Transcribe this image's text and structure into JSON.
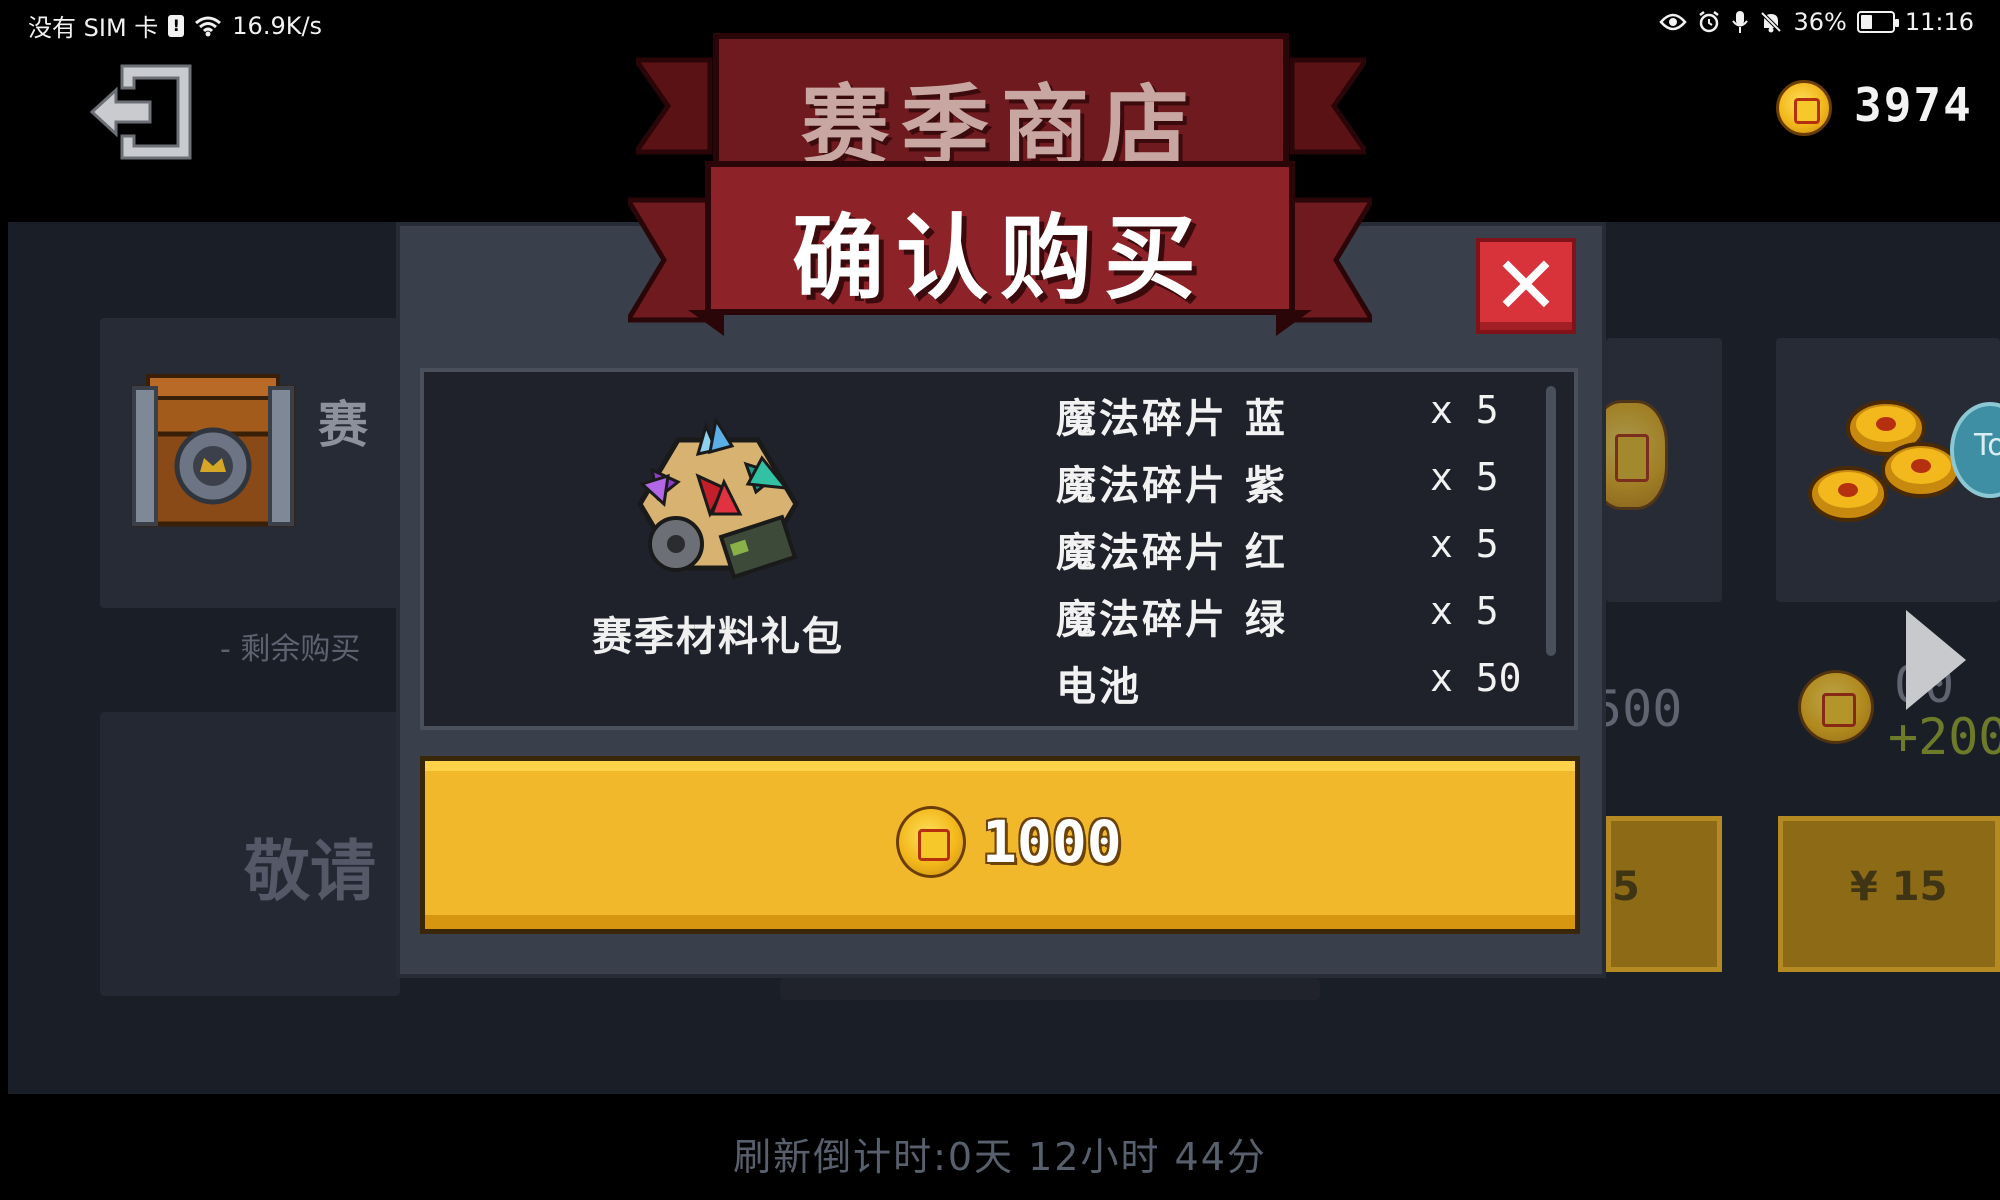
{
  "status_bar": {
    "carrier": "没有 SIM 卡",
    "net_speed": "16.9K/s",
    "battery": "36%",
    "battery_level": 0.36,
    "time": "11:16"
  },
  "header": {
    "shop_title": "赛季商店",
    "coins": "3974"
  },
  "dialog": {
    "title": "确认购买",
    "item_name": "赛季材料礼包",
    "rewards": [
      {
        "name": "魔法碎片 蓝",
        "qty": "x 5"
      },
      {
        "name": "魔法碎片 紫",
        "qty": "x 5"
      },
      {
        "name": "魔法碎片 红",
        "qty": "x 5"
      },
      {
        "name": "魔法碎片 绿",
        "qty": "x 5"
      },
      {
        "name": "电池",
        "qty": "x 50"
      }
    ],
    "price": "1000"
  },
  "background": {
    "card_title_partial": "赛",
    "remaining_label": "- 剩余购买",
    "notice_partial": "敬请",
    "partial_amount": "500",
    "partial_bonus": "+200",
    "partial_price_1": "5",
    "partial_price_2": "¥ 15",
    "partial_badge": "To",
    "refresh": "刷新倒计时:0天 12小时 44分"
  },
  "colors": {
    "ribbon_dark": "#6e1a1e",
    "ribbon_main": "#8e2229",
    "gold": "#f2b82c",
    "close_red": "#d8323a"
  },
  "icons": [
    "exit-icon",
    "coin-icon",
    "close-icon",
    "chest-icon",
    "material-pack-icon",
    "play-arrow-icon"
  ]
}
